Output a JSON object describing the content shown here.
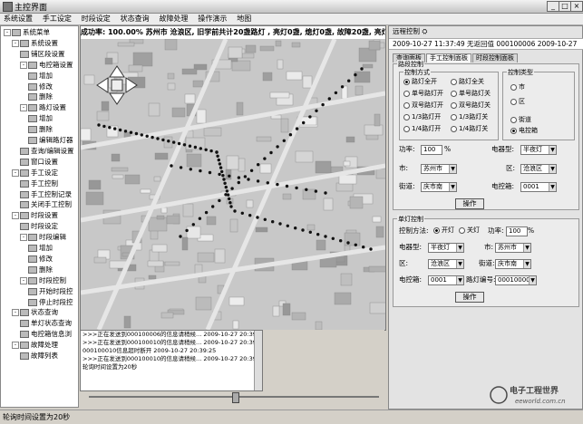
{
  "window": {
    "title": "主控界面",
    "min": "_",
    "max": "□",
    "close": "×"
  },
  "menu": [
    "系统设置",
    "手工设定",
    "时段设定",
    "状态查询",
    "故障处理",
    "操作演示",
    "地图"
  ],
  "tree": [
    {
      "label": "系统菜单",
      "depth": 0,
      "sign": "-"
    },
    {
      "label": "系统设置",
      "depth": 1,
      "sign": "-"
    },
    {
      "label": "铺区段设置",
      "depth": 2,
      "sign": ""
    },
    {
      "label": "电控箱设置",
      "depth": 2,
      "sign": "-"
    },
    {
      "label": "增加",
      "depth": 3,
      "sign": ""
    },
    {
      "label": "修改",
      "depth": 3,
      "sign": ""
    },
    {
      "label": "删除",
      "depth": 3,
      "sign": ""
    },
    {
      "label": "路灯设置",
      "depth": 2,
      "sign": "-"
    },
    {
      "label": "增加",
      "depth": 3,
      "sign": ""
    },
    {
      "label": "删除",
      "depth": 3,
      "sign": ""
    },
    {
      "label": "编辑路灯器",
      "depth": 3,
      "sign": ""
    },
    {
      "label": "查询/编辑设置",
      "depth": 2,
      "sign": ""
    },
    {
      "label": "窗口设置",
      "depth": 2,
      "sign": ""
    },
    {
      "label": "手工设定",
      "depth": 1,
      "sign": "-"
    },
    {
      "label": "手工控制",
      "depth": 2,
      "sign": ""
    },
    {
      "label": "手工控制记录",
      "depth": 2,
      "sign": ""
    },
    {
      "label": "关闭手工控制",
      "depth": 2,
      "sign": ""
    },
    {
      "label": "时段设置",
      "depth": 1,
      "sign": "-"
    },
    {
      "label": "时段设定",
      "depth": 2,
      "sign": ""
    },
    {
      "label": "时段编辑",
      "depth": 2,
      "sign": "-"
    },
    {
      "label": "增加",
      "depth": 3,
      "sign": ""
    },
    {
      "label": "修改",
      "depth": 3,
      "sign": ""
    },
    {
      "label": "删除",
      "depth": 3,
      "sign": ""
    },
    {
      "label": "时段控制",
      "depth": 2,
      "sign": "-"
    },
    {
      "label": "开始时段控",
      "depth": 3,
      "sign": ""
    },
    {
      "label": "停止时段控",
      "depth": 3,
      "sign": ""
    },
    {
      "label": "状态查询",
      "depth": 1,
      "sign": "-"
    },
    {
      "label": "单灯状态查询",
      "depth": 2,
      "sign": ""
    },
    {
      "label": "电控箱信息浏",
      "depth": 2,
      "sign": ""
    },
    {
      "label": "故障处理",
      "depth": 1,
      "sign": "-"
    },
    {
      "label": "故障列表",
      "depth": 2,
      "sign": ""
    }
  ],
  "map": {
    "status_text": "成功率: 100.00%    苏州市 沧浪区, 旧学前共计20盏路灯 , 亮灯0盏, 熄灯0盏, 故障20盏, 亮灯率"
  },
  "log": [
    ">>>正在发送到000100006的信息请稍候...  2009-10-27 20:39:08",
    ">>>正在发送到000100010的信息请稍候...  2009-10-27 20:39:16",
    "000100010信息超时断开  2009-10-27 20:39:25",
    "",
    ">>>正在发送到000100010的信息请稍候...  2009-10-27 20:39:28",
    "轮询时间设置为20秒"
  ],
  "status_bar": "轮询时间设置为20秒",
  "right": {
    "header": "远程控制 ⛭",
    "time_bar": "2009-10-27   11:37:49   无返回值   000100006   2009-10-27",
    "tabs": [
      "查询面板",
      "手工控制面板",
      "时段控制面板"
    ],
    "group_label": "路段控制",
    "control_mode_label": "控制方式",
    "control_options": [
      {
        "label": "路灯全开",
        "on": true
      },
      {
        "label": "路灯全关",
        "on": false
      },
      {
        "label": "单号路灯开",
        "on": false
      },
      {
        "label": "单号路灯关",
        "on": false
      },
      {
        "label": "双号路灯开",
        "on": false
      },
      {
        "label": "双号路灯关",
        "on": false
      },
      {
        "label": "1/3路灯开",
        "on": false
      },
      {
        "label": "1/3路灯关",
        "on": false
      },
      {
        "label": "1/4路灯开",
        "on": false
      },
      {
        "label": "1/4路灯关",
        "on": false
      }
    ],
    "control_type_label": "控制类型",
    "type_options": [
      {
        "label": "市",
        "on": false
      },
      {
        "label": "区",
        "on": false
      },
      {
        "label": "街道",
        "on": false
      },
      {
        "label": "电控箱",
        "on": true
      }
    ],
    "power_label": "功率:",
    "power_value": "100",
    "power_unit": "%",
    "lamp_type_label": "电器型:",
    "lamp_type_value": "半夜灯",
    "city_label": "市:",
    "city_value": "苏州市",
    "district_label": "区:",
    "district_value": "沧浪区",
    "street_label": "街道:",
    "street_value": "庆市南",
    "box_label": "电控箱:",
    "box_value": "0001",
    "operate_label": "操作",
    "single_group_label": "单灯控制",
    "single_mode_label": "控制方法:",
    "single_on_label": "开灯",
    "single_off_label": "关灯",
    "single_power_label": "功率:",
    "single_power_value": "100",
    "single_power_unit": "%",
    "single_lamp_type_label": "电器型:",
    "single_lamp_type_value": "半夜灯",
    "single_city_label": "市:",
    "single_city_value": "苏州市",
    "single_district_label": "区:",
    "single_district_value": "沧浪区",
    "single_street_label": "街道:",
    "single_street_value": "庆市南",
    "single_box_label": "电控箱:",
    "single_box_value": "0001",
    "single_lamp_no_label": "路灯编号:",
    "single_lamp_no_value": "000100001",
    "single_operate_label": "操作"
  },
  "watermark": {
    "line1": "电子工程世界",
    "line2": "eeworld.com.cn"
  }
}
